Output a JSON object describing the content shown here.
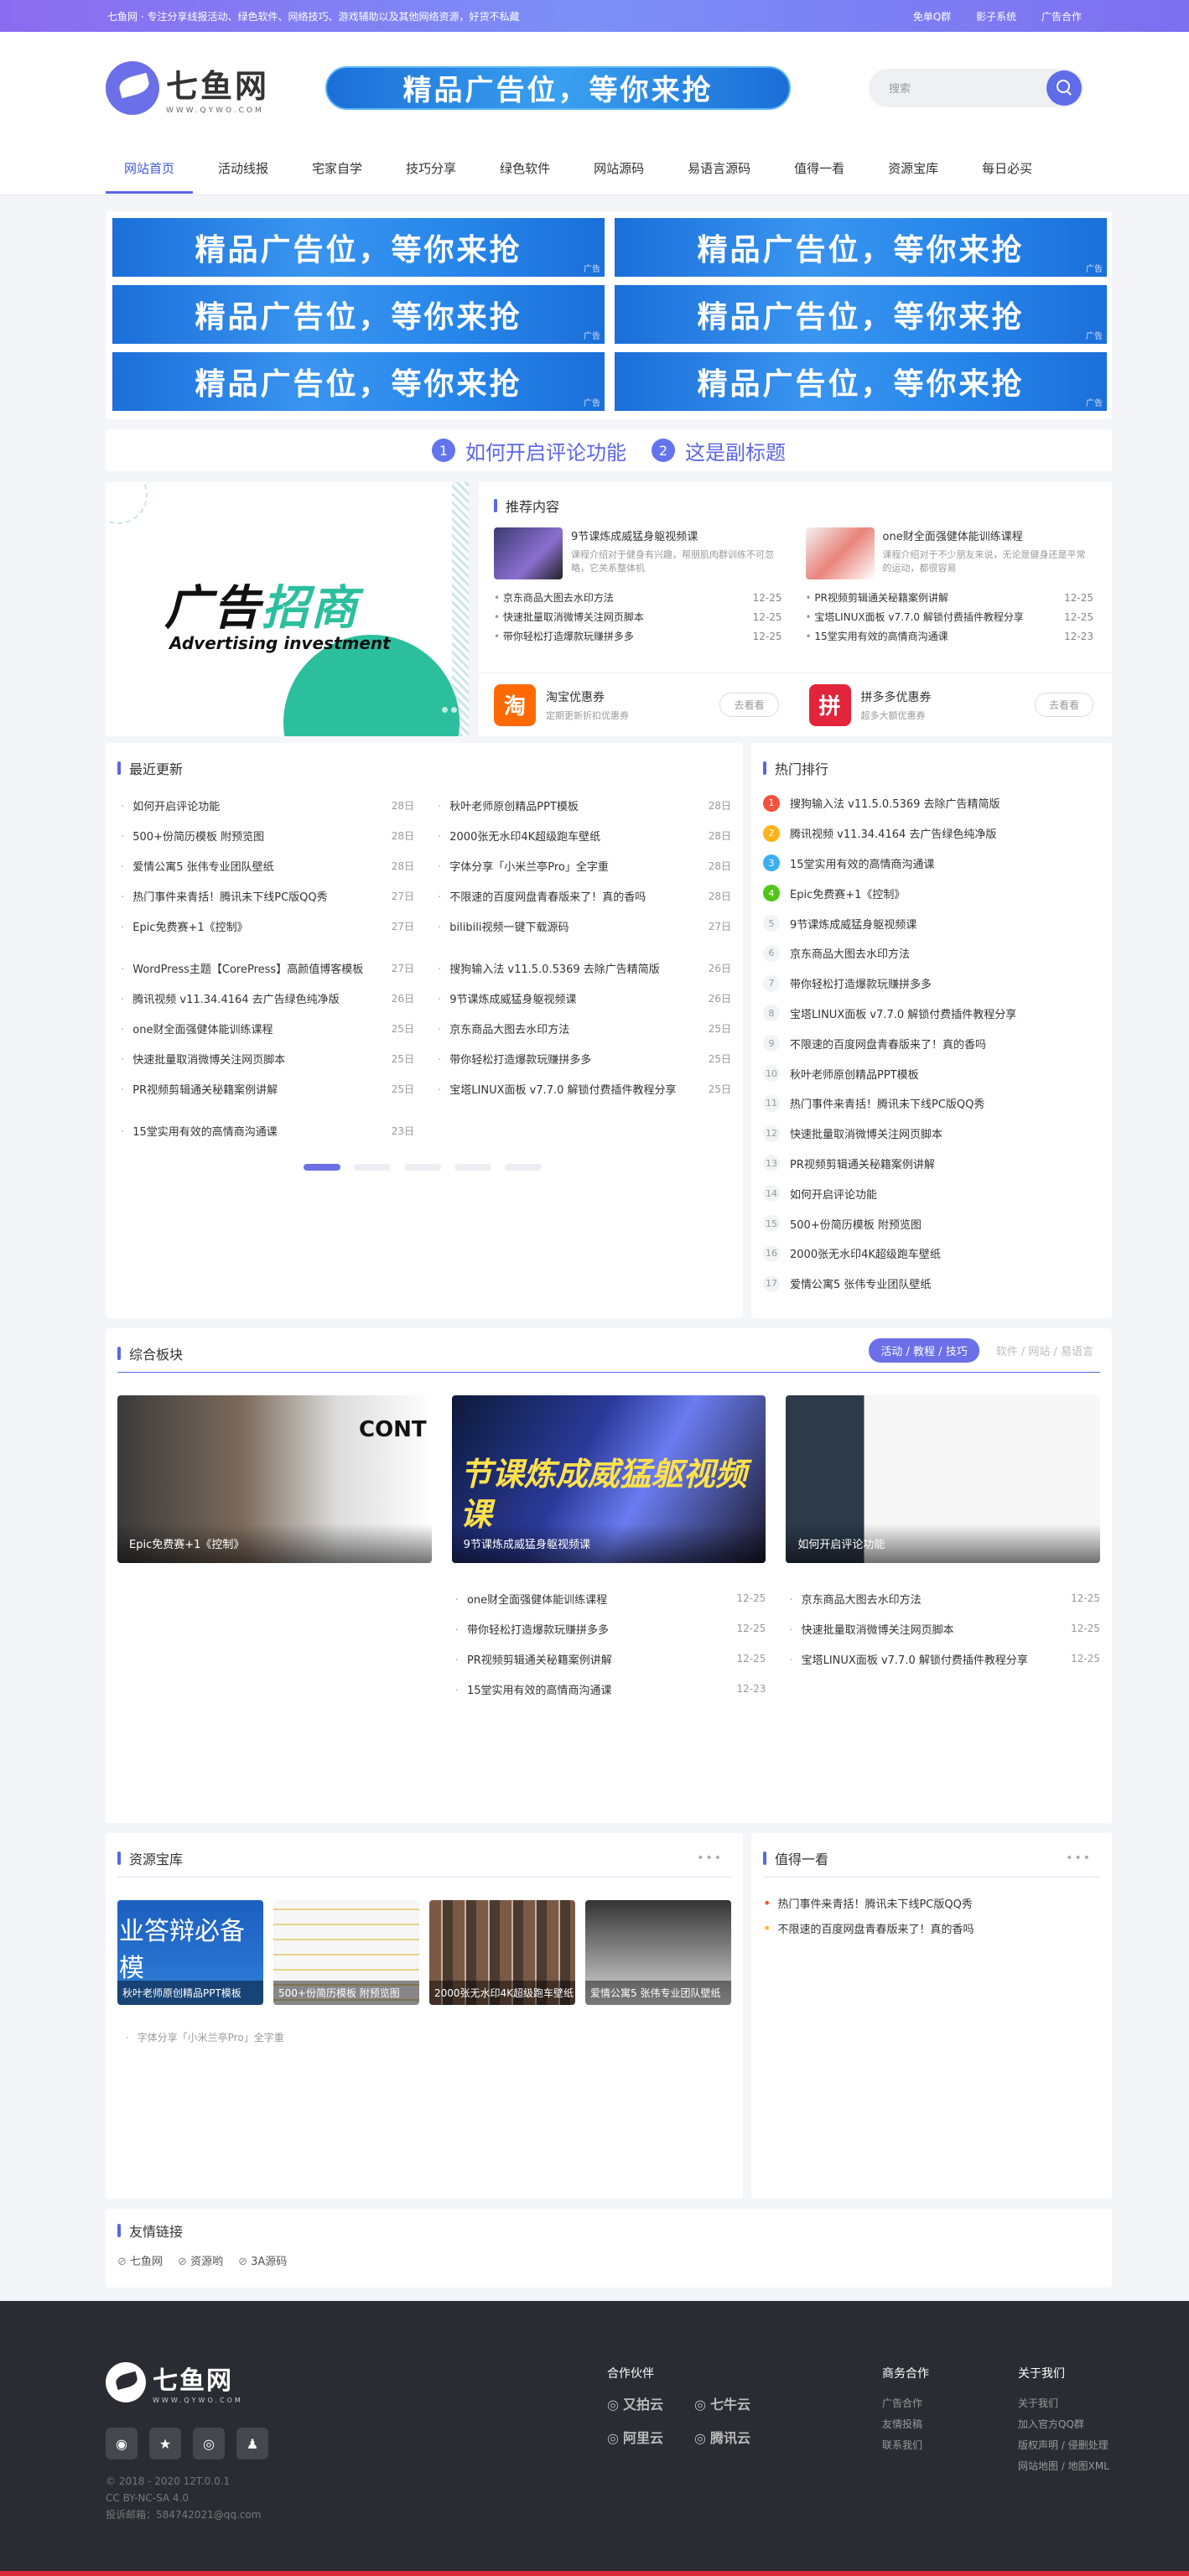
{
  "topbar": {
    "text": "七鱼网 · 专注分享线报活动、绿色软件、网络技巧、游戏辅助以及其他网络资源，好货不私藏",
    "links": [
      "免单Q群",
      "影子系统",
      "广告合作"
    ]
  },
  "logo": {
    "cn": "七鱼网",
    "en": "WWW.QYWO.COM"
  },
  "header_ad": "精品广告位，等你来抢",
  "search": {
    "placeholder": "搜索"
  },
  "nav": [
    "网站首页",
    "活动线报",
    "宅家自学",
    "技巧分享",
    "绿色软件",
    "网站源码",
    "易语言源码",
    "值得一看",
    "资源宝库",
    "每日必买"
  ],
  "ads": {
    "text": "精品广告位，等你来抢",
    "tag": "广告",
    "count": 6
  },
  "subtitle": {
    "n1": "1",
    "t1": "如何开启评论功能",
    "n2": "2",
    "t2": "这是副标题"
  },
  "promo": {
    "big_a": "广告",
    "big_b": "招商",
    "en": "Advertising investment"
  },
  "recommend": {
    "title": "推荐内容",
    "cols": [
      {
        "h": "9节课炼成威猛身躯视频课",
        "d": "课程介绍对于健身有兴趣，帮朋肌肉群训练不可忽略，它关系整体机",
        "items": [
          [
            "京东商品大图去水印方法",
            "12-25"
          ],
          [
            "快速批量取消微博关注网页脚本",
            "12-25"
          ],
          [
            "带你轻松打造爆款玩赚拼多多",
            "12-25"
          ]
        ]
      },
      {
        "h": "one财全面强健体能训练课程",
        "d": "课程介绍对于不少朋友来说，无论是健身还是平常的运动，都很容易",
        "items": [
          [
            "PR视频剪辑通关秘籍案例讲解",
            "12-25"
          ],
          [
            "宝塔LINUX面板 v7.7.0 解锁付费插件教程分享",
            "12-25"
          ],
          [
            "15堂实用有效的高情商沟通课",
            "12-23"
          ]
        ]
      }
    ],
    "coupons": [
      {
        "icon": "淘",
        "h": "淘宝优惠券",
        "d": "定期更新折扣优惠券",
        "go": "去看看"
      },
      {
        "icon": "拼",
        "h": "拼多多优惠券",
        "d": "超多大额优惠券",
        "go": "去看看"
      }
    ]
  },
  "latest": {
    "title": "最近更新",
    "left": [
      [
        "如何开启评论功能",
        "28日"
      ],
      [
        "500+份简历模板 附预览图",
        "28日"
      ],
      [
        "爱情公寓5 张伟专业团队壁纸",
        "28日"
      ],
      [
        "热门事件来青括！腾讯未下线PC版QQ秀",
        "27日"
      ],
      [
        "Epic免费赛+1《控制》",
        "27日"
      ],
      [
        "WordPress主题【CorePress】高颜值博客模板",
        "27日"
      ],
      [
        "腾讯视频 v11.34.4164 去广告绿色纯净版",
        "26日"
      ],
      [
        "one财全面强健体能训练课程",
        "25日"
      ],
      [
        "快速批量取消微博关注网页脚本",
        "25日"
      ],
      [
        "PR视频剪辑通关秘籍案例讲解",
        "25日"
      ],
      [
        "15堂实用有效的高情商沟通课",
        "23日"
      ]
    ],
    "right": [
      [
        "秋叶老师原创精品PPT模板",
        "28日"
      ],
      [
        "2000张无水印4K超级跑车壁纸",
        "28日"
      ],
      [
        "字体分享「小米兰亭Pro」全字重",
        "28日"
      ],
      [
        "不限速的百度网盘青春版来了！真的香吗",
        "28日"
      ],
      [
        "bilibili视频一键下载源码",
        "27日"
      ],
      [
        "搜狗输入法 v11.5.0.5369 去除广告精简版",
        "26日"
      ],
      [
        "9节课炼成威猛身躯视频课",
        "26日"
      ],
      [
        "京东商品大图去水印方法",
        "25日"
      ],
      [
        "带你轻松打造爆款玩赚拼多多",
        "25日"
      ],
      [
        "宝塔LINUX面板 v7.7.0 解锁付费插件教程分享",
        "25日"
      ]
    ]
  },
  "hot": {
    "title": "热门排行",
    "items": [
      "搜狗输入法 v11.5.0.5369 去除广告精简版",
      "腾讯视频 v11.34.4164 去广告绿色纯净版",
      "15堂实用有效的高情商沟通课",
      "Epic免费赛+1《控制》",
      "9节课炼成威猛身躯视频课",
      "京东商品大图去水印方法",
      "带你轻松打造爆款玩赚拼多多",
      "宝塔LINUX面板 v7.7.0 解锁付费插件教程分享",
      "不限速的百度网盘青春版来了！真的香吗",
      "秋叶老师原创精品PPT模板",
      "热门事件来青括！腾讯未下线PC版QQ秀",
      "快速批量取消微博关注网页脚本",
      "PR视频剪辑通关秘籍案例讲解",
      "如何开启评论功能",
      "500+份简历模板 附预览图",
      "2000张无水印4K超级跑车壁纸",
      "爱情公寓5 张伟专业团队壁纸"
    ]
  },
  "combo": {
    "title": "综合板块",
    "tab_on": "活动 / 教程 / 技巧",
    "tab_off": "软件 / 网站 / 易语言",
    "cards": [
      "Epic免费赛+1《控制》",
      "9节课炼成威猛身躯视频课",
      "如何开启评论功能"
    ],
    "slogan": "节课炼成威猛躯视频课",
    "cont": "CONT",
    "mid": [
      [
        "one财全面强健体能训练课程",
        "12-25"
      ],
      [
        "带你轻松打造爆款玩赚拼多多",
        "12-25"
      ],
      [
        "PR视频剪辑通关秘籍案例讲解",
        "12-25"
      ],
      [
        "15堂实用有效的高情商沟通课",
        "12-23"
      ]
    ],
    "right": [
      [
        "京东商品大图去水印方法",
        "12-25"
      ],
      [
        "快速批量取消微博关注网页脚本",
        "12-25"
      ],
      [
        "宝塔LINUX面板 v7.7.0 解锁付费插件教程分享",
        "12-25"
      ]
    ]
  },
  "resources": {
    "title": "资源宝库",
    "more": "•••",
    "bigt": "业答辩必备模",
    "imgs": [
      "秋叶老师原创精品PPT模板",
      "500+份简历模板 附预览图",
      "2000张无水印4K超级跑车壁纸",
      "爱情公寓5 张伟专业团队壁纸"
    ],
    "item": "字体分享「小米兰亭Pro」全字重"
  },
  "worth": {
    "title": "值得一看",
    "more": "•••",
    "items": [
      "热门事件来青括！腾讯未下线PC版QQ秀",
      "不限速的百度网盘青春版来了！真的香吗"
    ]
  },
  "friends": {
    "title": "友情链接",
    "items": [
      "七鱼网",
      "资源哟",
      "3A源码"
    ]
  },
  "footer": {
    "logo": "七鱼网",
    "en": "WWW.QYWO.COM",
    "meta": [
      "© 2018 - 2020 12T.0.0.1",
      "CC BY-NC-SA 4.0",
      "投诉邮箱：584742021@qq.com"
    ],
    "partners_title": "合作伙伴",
    "partners": [
      "又拍云",
      "七牛云",
      "阿里云",
      "腾讯云"
    ],
    "biz_title": "商务合作",
    "biz": [
      "广告合作",
      "友情投稿",
      "联系我们"
    ],
    "about_title": "关于我们",
    "about": [
      "关于我们",
      "加入官方QQ群",
      "版权声明 / 侵删处理",
      "网站地图 / 地图XML"
    ]
  }
}
